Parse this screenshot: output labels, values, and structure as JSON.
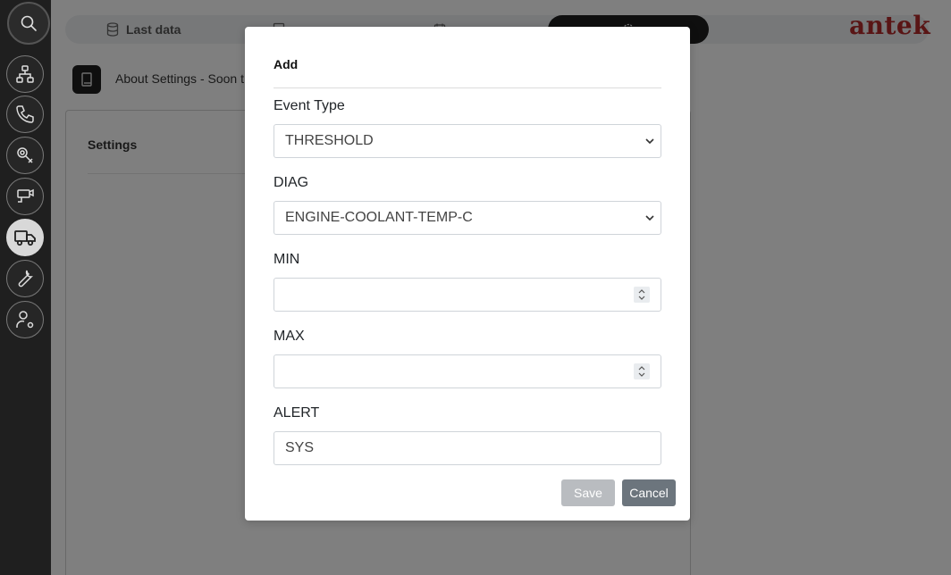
{
  "header": {
    "tabs": [
      {
        "label": "Last data",
        "icon": "database-icon"
      },
      {
        "label": "",
        "icon": "history-icon"
      },
      {
        "label": "",
        "icon": "calendar-icon"
      },
      {
        "label": "",
        "icon": "gear-icon"
      }
    ],
    "logo": "antek"
  },
  "sidebar": {
    "items": [
      {
        "icon": "search-icon"
      },
      {
        "icon": "network-icon"
      },
      {
        "icon": "phone-icon"
      },
      {
        "icon": "sensor-icon"
      },
      {
        "icon": "camera-icon"
      },
      {
        "icon": "truck-icon",
        "active": true
      },
      {
        "icon": "wrench-icon"
      },
      {
        "icon": "user-settings-icon"
      }
    ]
  },
  "page": {
    "about_text": "About Settings - Soon t",
    "settings_title": "Settings"
  },
  "modal": {
    "title": "Add",
    "event_type": {
      "label": "Event Type",
      "value": "THRESHOLD"
    },
    "diag": {
      "label": "DIAG",
      "value": "ENGINE-COOLANT-TEMP-C"
    },
    "min": {
      "label": "MIN",
      "value": ""
    },
    "max": {
      "label": "MAX",
      "value": ""
    },
    "alert": {
      "label": "ALERT",
      "value": "SYS"
    },
    "save_label": "Save",
    "cancel_label": "Cancel"
  },
  "colors": {
    "brand": "#b32a2a",
    "sidebar": "#1f1f1f",
    "save_disabled": "#b9bcc0",
    "cancel": "#6c757d"
  }
}
